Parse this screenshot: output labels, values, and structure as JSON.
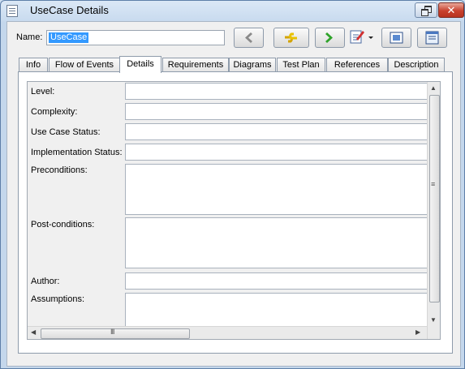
{
  "window": {
    "title": "UseCase Details",
    "close_glyph": "✕"
  },
  "name": {
    "label": "Name:",
    "value": "UseCase"
  },
  "toolbar": {
    "icons": [
      "back-arrow-icon",
      "link-icon",
      "forward-arrow-icon",
      "properties-icon",
      "fit-window-icon",
      "window-layout-icon"
    ]
  },
  "tabs": [
    {
      "label": "Info"
    },
    {
      "label": "Flow of Events"
    },
    {
      "label": "Details",
      "active": true
    },
    {
      "label": "Requirements"
    },
    {
      "label": "Diagrams"
    },
    {
      "label": "Test Plan"
    },
    {
      "label": "References"
    },
    {
      "label": "Description"
    }
  ],
  "fields": [
    {
      "label": "Level:",
      "value": ""
    },
    {
      "label": "Complexity:",
      "value": ""
    },
    {
      "label": "Use Case Status:",
      "value": ""
    },
    {
      "label": "Implementation Status:",
      "value": ""
    },
    {
      "label": "Preconditions:",
      "value": ""
    },
    {
      "label": "Post-conditions:",
      "value": ""
    },
    {
      "label": "Author:",
      "value": ""
    },
    {
      "label": "Assumptions:",
      "value": ""
    }
  ],
  "scrollbars": {
    "grip_v": "≡",
    "grip_h": "III",
    "up": "▲",
    "down": "▼",
    "left": "◀",
    "right": "▶"
  },
  "colors": {
    "selection": "#3399ff",
    "close_button": "#c8412e",
    "forward_arrow": "#2fa32a",
    "link": "#e0b000"
  }
}
